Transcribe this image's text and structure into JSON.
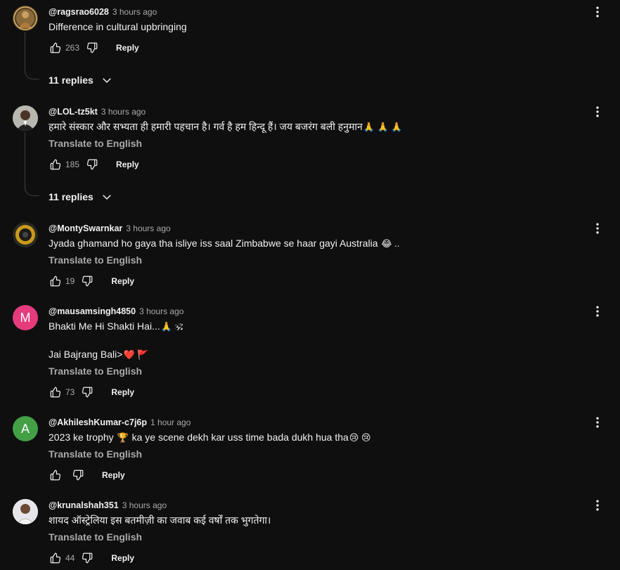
{
  "comments": [
    {
      "author": "@ragsrao6028",
      "time": "3 hours ago",
      "text": "Difference in cultural upbringing",
      "likes": "263",
      "reply": "Reply",
      "replies": "11 replies",
      "avatar_icon": "deity-image-avatar"
    },
    {
      "author": "@LOL-tz5kt",
      "time": "3 hours ago",
      "text": "हमारे संस्कार और सभ्यता ही हमारी पहचान है। गर्व है हम हिन्दू हैं। जय बजरंग बली हनुमान",
      "text_emojis": "🙏 🙏 🙏",
      "translate": "Translate to English",
      "likes": "185",
      "reply": "Reply",
      "replies": "11 replies",
      "avatar_icon": "person-photo-avatar"
    },
    {
      "author": "@MontySwarnkar",
      "time": "3 hours ago",
      "text": "Jyada ghamand ho gaya tha isliye iss saal Zimbabwe se haar gayi Australia",
      "text_emojis": "😂 ..",
      "translate": "Translate to English",
      "likes": "19",
      "reply": "Reply",
      "avatar_icon": "speaker-avatar"
    },
    {
      "author": "@mausamsingh4850",
      "time": "3 hours ago",
      "text": "Bhakti Me Hi Shakti Hai...",
      "text_emojis": "🙏 🕉",
      "text2": "Jai Bajrang Bali>",
      "text2_emojis": "❤️ 🚩",
      "translate": "Translate to English",
      "likes": "73",
      "reply": "Reply",
      "avatar_letter": "M",
      "avatar_color": "#e53b7d"
    },
    {
      "author": "@AkhileshKumar-c7j6p",
      "time": "1 hour ago",
      "text_a": "2023 ke trophy",
      "text_emoji_a": "🏆",
      "text_b": "ka ye scene dekh kar uss time bada dukh hua tha",
      "text_emojis": "😢 😢",
      "translate": "Translate to English",
      "reply": "Reply",
      "avatar_letter": "A",
      "avatar_color": "#43a047"
    },
    {
      "author": "@krunalshah351",
      "time": "3 hours ago",
      "text": "शायद ऑस्ट्रेलिया इस बतमीज़ी का जवाब कई वर्षों तक भुगतेगा।",
      "translate": "Translate to English",
      "likes": "44",
      "reply": "Reply",
      "avatar_icon": "person-photo-avatar"
    }
  ],
  "icons": {
    "like": "thumbs-up-icon",
    "dislike": "thumbs-down-icon",
    "menu": "more-vertical-icon",
    "expand": "chevron-down-icon"
  },
  "colors": {
    "background": "#0f0f0f",
    "text": "#f1f1f1",
    "secondary_text": "#aaaaaa",
    "avatar_m": "#e53b7d",
    "avatar_a": "#43a047"
  }
}
